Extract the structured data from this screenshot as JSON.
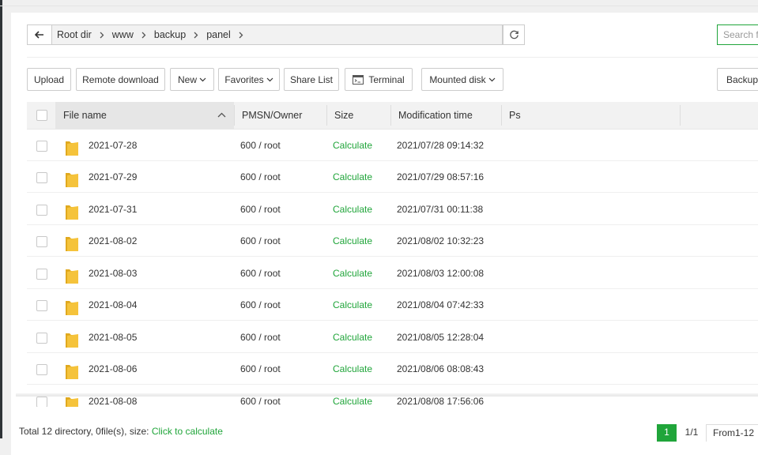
{
  "path": {
    "crumbs": [
      "Root dir",
      "www",
      "backup",
      "panel"
    ]
  },
  "search": {
    "placeholder": "Search fi"
  },
  "toolbar": {
    "upload": "Upload",
    "remote_download": "Remote download",
    "new": "New",
    "favorites": "Favorites",
    "share_list": "Share List",
    "terminal": "Terminal",
    "mounted_disk": "Mounted disk",
    "backup": "Backup"
  },
  "table": {
    "headers": {
      "file_name": "File name",
      "owner": "PMSN/Owner",
      "size": "Size",
      "mtime": "Modification time",
      "ps": "Ps"
    },
    "rows": [
      {
        "name": "2021-07-28",
        "owner": "600 / root",
        "size": "Calculate",
        "mtime": "2021/07/28 09:14:32"
      },
      {
        "name": "2021-07-29",
        "owner": "600 / root",
        "size": "Calculate",
        "mtime": "2021/07/29 08:57:16"
      },
      {
        "name": "2021-07-31",
        "owner": "600 / root",
        "size": "Calculate",
        "mtime": "2021/07/31 00:11:38"
      },
      {
        "name": "2021-08-02",
        "owner": "600 / root",
        "size": "Calculate",
        "mtime": "2021/08/02 10:32:23"
      },
      {
        "name": "2021-08-03",
        "owner": "600 / root",
        "size": "Calculate",
        "mtime": "2021/08/03 12:00:08"
      },
      {
        "name": "2021-08-04",
        "owner": "600 / root",
        "size": "Calculate",
        "mtime": "2021/08/04 07:42:33"
      },
      {
        "name": "2021-08-05",
        "owner": "600 / root",
        "size": "Calculate",
        "mtime": "2021/08/05 12:28:04"
      },
      {
        "name": "2021-08-06",
        "owner": "600 / root",
        "size": "Calculate",
        "mtime": "2021/08/06 08:08:43"
      },
      {
        "name": "2021-08-08",
        "owner": "600 / root",
        "size": "Calculate",
        "mtime": "2021/08/08 17:56:06"
      }
    ]
  },
  "footer": {
    "summary": "Total 12 directory, 0file(s), size: ",
    "calc_link": "Click to calculate"
  },
  "pagination": {
    "current": "1",
    "pages": "1/1",
    "range": "From1-12"
  },
  "colors": {
    "accent": "#20a53a",
    "folder": "#f5c33b"
  },
  "icons": {
    "back": "arrow-left-icon",
    "refresh": "refresh-icon",
    "chevron": "chevron-down-icon",
    "sort": "chevron-up-icon",
    "terminal": "terminal-icon",
    "folder": "folder-icon"
  }
}
